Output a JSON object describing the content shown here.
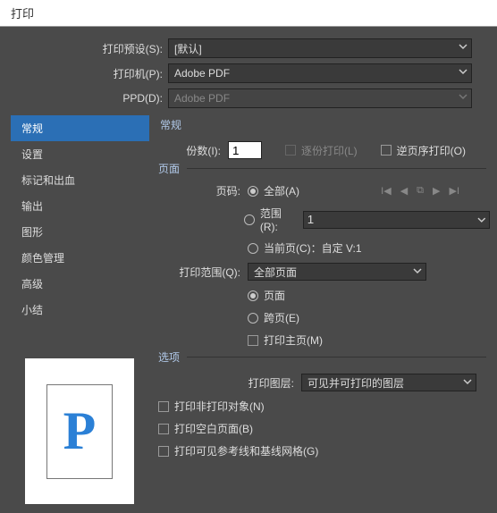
{
  "title": "打印",
  "top": {
    "preset_label": "打印预设(S):",
    "preset_value": "[默认]",
    "printer_label": "打印机(P):",
    "printer_value": "Adobe PDF",
    "ppd_label": "PPD(D):",
    "ppd_value": "Adobe PDF"
  },
  "sidebar": {
    "items": [
      "常规",
      "设置",
      "标记和出血",
      "输出",
      "图形",
      "颜色管理",
      "高级",
      "小结"
    ]
  },
  "preview_letter": "P",
  "main": {
    "panel_title": "常规",
    "copies_label": "份数(I):",
    "copies_value": "1",
    "collate": "逐份打印(L)",
    "reverse": "逆页序打印(O)",
    "pages_group": "页面",
    "page_num_label": "页码:",
    "all": "全部(A)",
    "range": "范围(R):",
    "range_value": "1",
    "current": "当前页(C)：自定 V:1",
    "scope_label": "打印范围(Q):",
    "scope_value": "全部页面",
    "page": "页面",
    "spread": "跨页(E)",
    "master": "打印主页(M)",
    "options_group": "选项",
    "layer_label": "打印图层:",
    "layer_value": "可见并可打印的图层",
    "nonprint": "打印非打印对象(N)",
    "blank": "打印空白页面(B)",
    "guides": "打印可见参考线和基线网格(G)"
  }
}
